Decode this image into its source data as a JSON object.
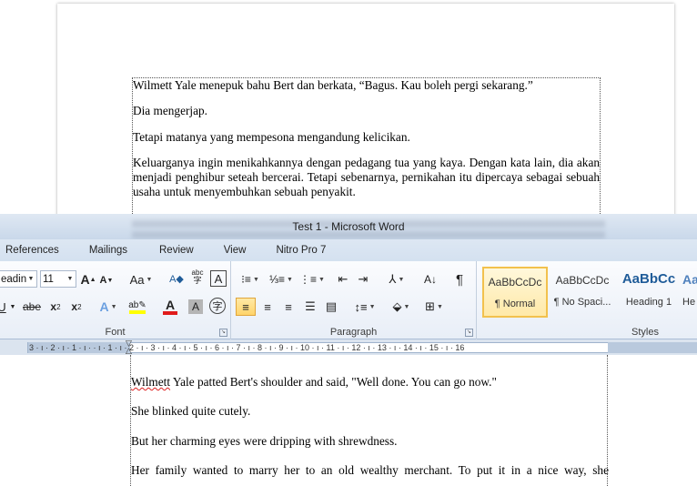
{
  "document_top": {
    "paragraphs": [
      "Wilmett Yale menepuk bahu Bert dan berkata, “Bagus. Kau boleh pergi sekarang.”",
      "Dia mengerjap.",
      "Tetapi matanya yang mempesona mengandung kelicikan.",
      "Keluarganya ingin menikahkannya dengan pedagang tua yang kaya. Dengan kata lain, dia akan menjadi penghibur seteah bercerai. Tetapi sebenarnya, pernikahan itu dipercaya sebagai sebuah usaha untuk menyembuhkan sebuah penyakit."
    ]
  },
  "window": {
    "title": "Test 1  -  Microsoft Word"
  },
  "ribbon_tabs": [
    "References",
    "Mailings",
    "Review",
    "View",
    "Nitro Pro 7"
  ],
  "font_group": {
    "font_name": "eadin",
    "font_size": "11",
    "label": "Font"
  },
  "paragraph_group": {
    "label": "Paragraph"
  },
  "styles_group": {
    "label": "Styles",
    "styles": [
      {
        "sample": "AaBbCcDc",
        "name": "¶ Normal"
      },
      {
        "sample": "AaBbCcDc",
        "name": "¶ No Spaci..."
      },
      {
        "sample": "AaBbCc",
        "name": "Heading 1"
      },
      {
        "sample": "Aa",
        "name": "He"
      }
    ]
  },
  "ruler": {
    "text": "3 · ı · 2 · ı · 1 · ı ·   · ı · 1 · ı · 2 · ı · 3 · ı · 4 · ı · 5 · ı · 6 · ı · 7 · ı · 8 · ı · 9 · ı · 10 · ı · 11 · ı · 12 · ı · 13 · ı · 14 · ı · 15 · ı · 16"
  },
  "document_lower": {
    "name_part": "Wilmett",
    "first_rest": " Yale patted Bert's shoulder and said, \"Well done. You can go now.\"",
    "paragraphs": [
      "She blinked quite cutely.",
      "But her charming eyes were dripping with shrewdness.",
      "Her family wanted to marry her to an old wealthy merchant. To put it in a nice way, she"
    ]
  },
  "colors": {
    "highlight_yellow": "#ffff00",
    "font_red": "#e01b1b",
    "accent_heading": "#1f5c99",
    "active_style_border": "#f2c14d"
  }
}
